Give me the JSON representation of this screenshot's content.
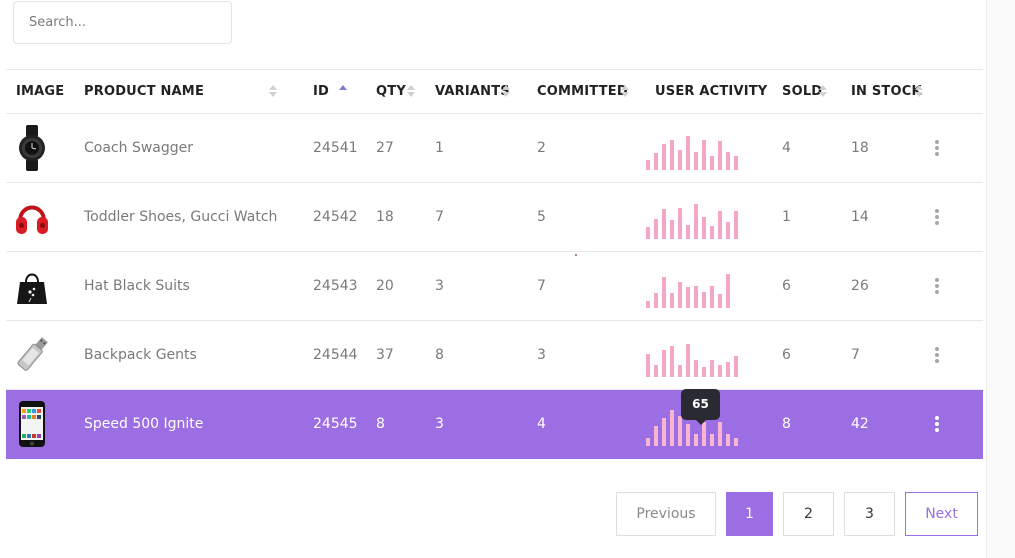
{
  "search": {
    "placeholder": "Search..."
  },
  "columns": {
    "image": "IMAGE",
    "product_name": "PRODUCT NAME",
    "id": "ID",
    "qty": "QTY",
    "variants": "VARIANTS",
    "committed": "COMMITTED",
    "user_activity": "USER ACTIVITY",
    "sold": "SOLD",
    "in_stock": "IN STOCK"
  },
  "sort": {
    "column": "id",
    "direction": "ascending"
  },
  "rows": [
    {
      "image_icon": "smartwatch-icon",
      "name": "Coach Swagger",
      "id": "24541",
      "qty": "27",
      "variants": "1",
      "committed": "2",
      "sold": "4",
      "in_stock": "18",
      "activity": [
        10,
        17,
        26,
        30,
        20,
        34,
        18,
        30,
        14,
        29,
        18,
        14
      ],
      "selected": false
    },
    {
      "image_icon": "headphones-icon",
      "name": "Toddler Shoes, Gucci Watch",
      "id": "24542",
      "qty": "18",
      "variants": "7",
      "committed": "5",
      "sold": "1",
      "in_stock": "14",
      "activity": [
        12,
        20,
        30,
        19,
        31,
        14,
        35,
        22,
        13,
        28,
        17,
        28,
        12
      ],
      "selected": false
    },
    {
      "image_icon": "handbag-icon",
      "name": "Hat Black Suits",
      "id": "24543",
      "qty": "20",
      "variants": "3",
      "committed": "7",
      "sold": "6",
      "in_stock": "26",
      "activity": [
        7,
        15,
        31,
        15,
        26,
        21,
        22,
        16,
        22,
        14,
        34
      ],
      "selected": false
    },
    {
      "image_icon": "usb-drive-icon",
      "name": "Backpack Gents",
      "id": "24544",
      "qty": "37",
      "variants": "8",
      "committed": "3",
      "sold": "6",
      "in_stock": "7",
      "activity": [
        23,
        12,
        27,
        31,
        12,
        33,
        17,
        10,
        17,
        12,
        15,
        21
      ],
      "selected": false
    },
    {
      "image_icon": "smartphone-icon",
      "name": "Speed 500 Ignite",
      "id": "24545",
      "qty": "8",
      "variants": "3",
      "committed": "4",
      "sold": "8",
      "in_stock": "42",
      "activity": [
        8,
        20,
        28,
        36,
        30,
        22,
        12,
        24,
        12,
        24,
        12,
        8,
        10
      ],
      "selected": true
    }
  ],
  "tooltip": {
    "value": "65"
  },
  "pagination": {
    "previous": "Previous",
    "pages": [
      "1",
      "2",
      "3"
    ],
    "current": "1",
    "next": "Next"
  },
  "colors": {
    "accent": "#9c6ee4",
    "bar": "#f4a6c6",
    "tooltip_bg": "#2a2a33"
  }
}
